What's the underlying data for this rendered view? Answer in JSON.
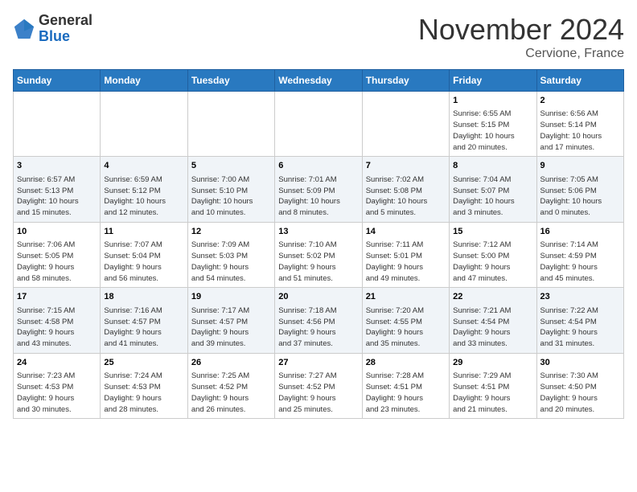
{
  "header": {
    "logo": {
      "general": "General",
      "blue": "Blue"
    },
    "title": "November 2024",
    "location": "Cervione, France"
  },
  "days_of_week": [
    "Sunday",
    "Monday",
    "Tuesday",
    "Wednesday",
    "Thursday",
    "Friday",
    "Saturday"
  ],
  "weeks": [
    [
      {
        "day": "",
        "info": ""
      },
      {
        "day": "",
        "info": ""
      },
      {
        "day": "",
        "info": ""
      },
      {
        "day": "",
        "info": ""
      },
      {
        "day": "",
        "info": ""
      },
      {
        "day": "1",
        "info": "Sunrise: 6:55 AM\nSunset: 5:15 PM\nDaylight: 10 hours\nand 20 minutes."
      },
      {
        "day": "2",
        "info": "Sunrise: 6:56 AM\nSunset: 5:14 PM\nDaylight: 10 hours\nand 17 minutes."
      }
    ],
    [
      {
        "day": "3",
        "info": "Sunrise: 6:57 AM\nSunset: 5:13 PM\nDaylight: 10 hours\nand 15 minutes."
      },
      {
        "day": "4",
        "info": "Sunrise: 6:59 AM\nSunset: 5:12 PM\nDaylight: 10 hours\nand 12 minutes."
      },
      {
        "day": "5",
        "info": "Sunrise: 7:00 AM\nSunset: 5:10 PM\nDaylight: 10 hours\nand 10 minutes."
      },
      {
        "day": "6",
        "info": "Sunrise: 7:01 AM\nSunset: 5:09 PM\nDaylight: 10 hours\nand 8 minutes."
      },
      {
        "day": "7",
        "info": "Sunrise: 7:02 AM\nSunset: 5:08 PM\nDaylight: 10 hours\nand 5 minutes."
      },
      {
        "day": "8",
        "info": "Sunrise: 7:04 AM\nSunset: 5:07 PM\nDaylight: 10 hours\nand 3 minutes."
      },
      {
        "day": "9",
        "info": "Sunrise: 7:05 AM\nSunset: 5:06 PM\nDaylight: 10 hours\nand 0 minutes."
      }
    ],
    [
      {
        "day": "10",
        "info": "Sunrise: 7:06 AM\nSunset: 5:05 PM\nDaylight: 9 hours\nand 58 minutes."
      },
      {
        "day": "11",
        "info": "Sunrise: 7:07 AM\nSunset: 5:04 PM\nDaylight: 9 hours\nand 56 minutes."
      },
      {
        "day": "12",
        "info": "Sunrise: 7:09 AM\nSunset: 5:03 PM\nDaylight: 9 hours\nand 54 minutes."
      },
      {
        "day": "13",
        "info": "Sunrise: 7:10 AM\nSunset: 5:02 PM\nDaylight: 9 hours\nand 51 minutes."
      },
      {
        "day": "14",
        "info": "Sunrise: 7:11 AM\nSunset: 5:01 PM\nDaylight: 9 hours\nand 49 minutes."
      },
      {
        "day": "15",
        "info": "Sunrise: 7:12 AM\nSunset: 5:00 PM\nDaylight: 9 hours\nand 47 minutes."
      },
      {
        "day": "16",
        "info": "Sunrise: 7:14 AM\nSunset: 4:59 PM\nDaylight: 9 hours\nand 45 minutes."
      }
    ],
    [
      {
        "day": "17",
        "info": "Sunrise: 7:15 AM\nSunset: 4:58 PM\nDaylight: 9 hours\nand 43 minutes."
      },
      {
        "day": "18",
        "info": "Sunrise: 7:16 AM\nSunset: 4:57 PM\nDaylight: 9 hours\nand 41 minutes."
      },
      {
        "day": "19",
        "info": "Sunrise: 7:17 AM\nSunset: 4:57 PM\nDaylight: 9 hours\nand 39 minutes."
      },
      {
        "day": "20",
        "info": "Sunrise: 7:18 AM\nSunset: 4:56 PM\nDaylight: 9 hours\nand 37 minutes."
      },
      {
        "day": "21",
        "info": "Sunrise: 7:20 AM\nSunset: 4:55 PM\nDaylight: 9 hours\nand 35 minutes."
      },
      {
        "day": "22",
        "info": "Sunrise: 7:21 AM\nSunset: 4:54 PM\nDaylight: 9 hours\nand 33 minutes."
      },
      {
        "day": "23",
        "info": "Sunrise: 7:22 AM\nSunset: 4:54 PM\nDaylight: 9 hours\nand 31 minutes."
      }
    ],
    [
      {
        "day": "24",
        "info": "Sunrise: 7:23 AM\nSunset: 4:53 PM\nDaylight: 9 hours\nand 30 minutes."
      },
      {
        "day": "25",
        "info": "Sunrise: 7:24 AM\nSunset: 4:53 PM\nDaylight: 9 hours\nand 28 minutes."
      },
      {
        "day": "26",
        "info": "Sunrise: 7:25 AM\nSunset: 4:52 PM\nDaylight: 9 hours\nand 26 minutes."
      },
      {
        "day": "27",
        "info": "Sunrise: 7:27 AM\nSunset: 4:52 PM\nDaylight: 9 hours\nand 25 minutes."
      },
      {
        "day": "28",
        "info": "Sunrise: 7:28 AM\nSunset: 4:51 PM\nDaylight: 9 hours\nand 23 minutes."
      },
      {
        "day": "29",
        "info": "Sunrise: 7:29 AM\nSunset: 4:51 PM\nDaylight: 9 hours\nand 21 minutes."
      },
      {
        "day": "30",
        "info": "Sunrise: 7:30 AM\nSunset: 4:50 PM\nDaylight: 9 hours\nand 20 minutes."
      }
    ]
  ]
}
